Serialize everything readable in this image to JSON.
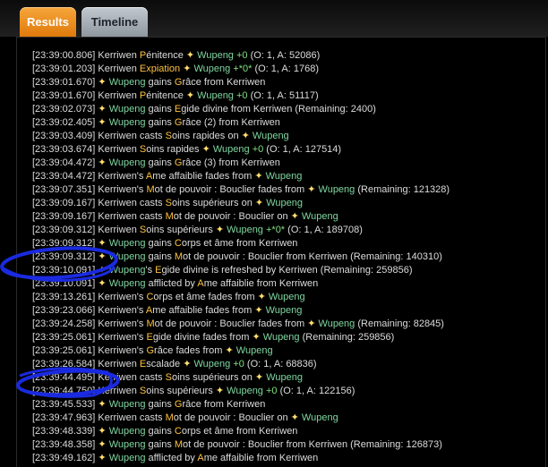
{
  "tabs": [
    {
      "label": "Results"
    },
    {
      "label": "Timeline"
    }
  ],
  "colors": {
    "accent_tab": "#f0901e",
    "player_wupeng": "#7fd6a0",
    "spell_highlight": "#ffc23d",
    "value_green": "#7fe07f",
    "annotation": "#1a2ae0"
  },
  "icons": {
    "target_marker": "star-icon"
  },
  "log": [
    [
      [
        "[23:39:00.806] ",
        "ts"
      ],
      [
        "Kerriwen ",
        "k"
      ],
      [
        "P",
        "o"
      ],
      [
        "énitence ",
        "k"
      ],
      [
        "✦ ",
        "star"
      ],
      [
        "Wupeng ",
        "w"
      ],
      [
        "+0",
        "g"
      ],
      [
        " (O: 1, A: 52086)",
        "k"
      ]
    ],
    [
      [
        "[23:39:01.203] ",
        "ts"
      ],
      [
        "Kerriwen ",
        "k"
      ],
      [
        "Expiation ",
        "o"
      ],
      [
        "✦ ",
        "star"
      ],
      [
        "Wupeng ",
        "w"
      ],
      [
        "+*0*",
        "g"
      ],
      [
        " (O: 1, A: 1768)",
        "k"
      ]
    ],
    [
      [
        "[23:39:01.670] ",
        "ts"
      ],
      [
        "✦ ",
        "star"
      ],
      [
        "Wupeng ",
        "w"
      ],
      [
        "gains ",
        "k"
      ],
      [
        "G",
        "o"
      ],
      [
        "râce from Kerriwen",
        "k"
      ]
    ],
    [
      [
        "[23:39:01.670] ",
        "ts"
      ],
      [
        "Kerriwen ",
        "k"
      ],
      [
        "P",
        "o"
      ],
      [
        "énitence ",
        "k"
      ],
      [
        "✦ ",
        "star"
      ],
      [
        "Wupeng ",
        "w"
      ],
      [
        "+0",
        "g"
      ],
      [
        " (O: 1, A: 51117)",
        "k"
      ]
    ],
    [
      [
        "[23:39:02.073] ",
        "ts"
      ],
      [
        "✦ ",
        "star"
      ],
      [
        "Wupeng ",
        "w"
      ],
      [
        "gains ",
        "k"
      ],
      [
        "E",
        "o"
      ],
      [
        "gide divine from Kerriwen (Remaining: 2400)",
        "k"
      ]
    ],
    [
      [
        "[23:39:02.405] ",
        "ts"
      ],
      [
        "✦ ",
        "star"
      ],
      [
        "Wupeng ",
        "w"
      ],
      [
        "gains ",
        "k"
      ],
      [
        "G",
        "o"
      ],
      [
        "râce (2) from Kerriwen",
        "k"
      ]
    ],
    [
      [
        "[23:39:03.409] ",
        "ts"
      ],
      [
        "Kerriwen casts ",
        "k"
      ],
      [
        "S",
        "o"
      ],
      [
        "oins rapides on ",
        "k"
      ],
      [
        "✦ ",
        "star"
      ],
      [
        "Wupeng",
        "w"
      ]
    ],
    [
      [
        "[23:39:03.674] ",
        "ts"
      ],
      [
        "Kerriwen ",
        "k"
      ],
      [
        "S",
        "o"
      ],
      [
        "oins rapides ",
        "k"
      ],
      [
        "✦ ",
        "star"
      ],
      [
        "Wupeng ",
        "w"
      ],
      [
        "+0",
        "g"
      ],
      [
        " (O: 1, A: 127514)",
        "k"
      ]
    ],
    [
      [
        "[23:39:04.472] ",
        "ts"
      ],
      [
        "✦ ",
        "star"
      ],
      [
        "Wupeng ",
        "w"
      ],
      [
        "gains ",
        "k"
      ],
      [
        "G",
        "o"
      ],
      [
        "râce (3) from Kerriwen",
        "k"
      ]
    ],
    [
      [
        "[23:39:04.472] ",
        "ts"
      ],
      [
        "Kerriwen's ",
        "k"
      ],
      [
        "A",
        "o"
      ],
      [
        "me affaiblie fades from ",
        "k"
      ],
      [
        "✦ ",
        "star"
      ],
      [
        "Wupeng",
        "w"
      ]
    ],
    [
      [
        "[23:39:07.351] ",
        "ts"
      ],
      [
        "Kerriwen's ",
        "k"
      ],
      [
        "M",
        "o"
      ],
      [
        "ot de pouvoir : Bouclier fades from ",
        "k"
      ],
      [
        "✦ ",
        "star"
      ],
      [
        "Wupeng ",
        "w"
      ],
      [
        "(Remaining: 121328)",
        "k"
      ]
    ],
    [
      [
        "[23:39:09.167] ",
        "ts"
      ],
      [
        "Kerriwen casts ",
        "k"
      ],
      [
        "S",
        "o"
      ],
      [
        "oins supérieurs on ",
        "k"
      ],
      [
        "✦ ",
        "star"
      ],
      [
        "Wupeng",
        "w"
      ]
    ],
    [
      [
        "[23:39:09.167] ",
        "ts"
      ],
      [
        "Kerriwen casts ",
        "k"
      ],
      [
        "M",
        "o"
      ],
      [
        "ot de pouvoir : Bouclier on ",
        "k"
      ],
      [
        "✦ ",
        "star"
      ],
      [
        "Wupeng",
        "w"
      ]
    ],
    [
      [
        "[23:39:09.312] ",
        "ts"
      ],
      [
        "Kerriwen ",
        "k"
      ],
      [
        "S",
        "o"
      ],
      [
        "oins supérieurs ",
        "k"
      ],
      [
        "✦ ",
        "star"
      ],
      [
        "Wupeng ",
        "w"
      ],
      [
        "+*0*",
        "g"
      ],
      [
        " (O: 1, A: 189708)",
        "k"
      ]
    ],
    [
      [
        "[23:39:09.312] ",
        "ts"
      ],
      [
        "✦ ",
        "star"
      ],
      [
        "Wupeng ",
        "w"
      ],
      [
        "gains ",
        "k"
      ],
      [
        "C",
        "o"
      ],
      [
        "orps et âme from Kerriwen",
        "k"
      ]
    ],
    [
      [
        "[23:39:09.312] ",
        "ts"
      ],
      [
        "✦ ",
        "star"
      ],
      [
        "Wupeng ",
        "w"
      ],
      [
        "gains ",
        "k"
      ],
      [
        "M",
        "o"
      ],
      [
        "ot de pouvoir : Bouclier from Kerriwen (Remaining: 140310)",
        "k"
      ]
    ],
    [
      [
        "[23:39:10.091] ",
        "ts"
      ],
      [
        "✦ ",
        "star"
      ],
      [
        "Wupeng",
        "w"
      ],
      [
        "'s ",
        "k"
      ],
      [
        "E",
        "o"
      ],
      [
        "gide divine is refreshed by Kerriwen (Remaining: 259856)",
        "k"
      ]
    ],
    [
      [
        "[23:39:10.091] ",
        "ts"
      ],
      [
        "✦ ",
        "star"
      ],
      [
        "Wupeng ",
        "w"
      ],
      [
        "afflicted by ",
        "k"
      ],
      [
        "A",
        "o"
      ],
      [
        "me affaiblie from Kerriwen",
        "k"
      ]
    ],
    [
      [
        "[23:39:13.261] ",
        "ts"
      ],
      [
        "Kerriwen's ",
        "k"
      ],
      [
        "C",
        "o"
      ],
      [
        "orps et âme fades from ",
        "k"
      ],
      [
        "✦ ",
        "star"
      ],
      [
        "Wupeng",
        "w"
      ]
    ],
    [
      [
        "[23:39:23.066] ",
        "ts"
      ],
      [
        "Kerriwen's ",
        "k"
      ],
      [
        "A",
        "o"
      ],
      [
        "me affaiblie fades from ",
        "k"
      ],
      [
        "✦ ",
        "star"
      ],
      [
        "Wupeng",
        "w"
      ]
    ],
    [
      [
        "[23:39:24.258] ",
        "ts"
      ],
      [
        "Kerriwen's ",
        "k"
      ],
      [
        "M",
        "o"
      ],
      [
        "ot de pouvoir : Bouclier fades from ",
        "k"
      ],
      [
        "✦ ",
        "star"
      ],
      [
        "Wupeng ",
        "w"
      ],
      [
        "(Remaining: 82845)",
        "k"
      ]
    ],
    [
      [
        "[23:39:25.061] ",
        "ts"
      ],
      [
        "Kerriwen's ",
        "k"
      ],
      [
        "E",
        "o"
      ],
      [
        "gide divine fades from ",
        "k"
      ],
      [
        "✦ ",
        "star"
      ],
      [
        "Wupeng ",
        "w"
      ],
      [
        "(Remaining: 259856)",
        "k"
      ]
    ],
    [
      [
        "[23:39:25.061] ",
        "ts"
      ],
      [
        "Kerriwen's ",
        "k"
      ],
      [
        "G",
        "o"
      ],
      [
        "râce fades from ",
        "k"
      ],
      [
        "✦ ",
        "star"
      ],
      [
        "Wupeng",
        "w"
      ]
    ],
    [
      [
        "[23:39:26.584] ",
        "ts"
      ],
      [
        "Kerriwen ",
        "k"
      ],
      [
        "E",
        "o"
      ],
      [
        "scalade ",
        "k"
      ],
      [
        "✦ ",
        "star"
      ],
      [
        "Wupeng ",
        "w"
      ],
      [
        "+0",
        "g"
      ],
      [
        " (O: 1, A: 68836)",
        "k"
      ]
    ],
    [
      [
        "[23:39:44.495] ",
        "ts"
      ],
      [
        "Kerriwen casts ",
        "k"
      ],
      [
        "S",
        "o"
      ],
      [
        "oins supérieurs on ",
        "k"
      ],
      [
        "✦ ",
        "star"
      ],
      [
        "Wupeng",
        "w"
      ]
    ],
    [
      [
        "[23:39:44.750] ",
        "ts"
      ],
      [
        "Kerriwen ",
        "k"
      ],
      [
        "S",
        "o"
      ],
      [
        "oins supérieurs ",
        "k"
      ],
      [
        "✦ ",
        "star"
      ],
      [
        "Wupeng ",
        "w"
      ],
      [
        "+0",
        "g"
      ],
      [
        " (O: 1, A: 122156)",
        "k"
      ]
    ],
    [
      [
        "[23:39:45.533] ",
        "ts"
      ],
      [
        "✦ ",
        "star"
      ],
      [
        "Wupeng ",
        "w"
      ],
      [
        "gains ",
        "k"
      ],
      [
        "G",
        "o"
      ],
      [
        "râce from Kerriwen",
        "k"
      ]
    ],
    [
      [
        "[23:39:47.963] ",
        "ts"
      ],
      [
        "Kerriwen casts ",
        "k"
      ],
      [
        "M",
        "o"
      ],
      [
        "ot de pouvoir : Bouclier on ",
        "k"
      ],
      [
        "✦ ",
        "star"
      ],
      [
        "Wupeng",
        "w"
      ]
    ],
    [
      [
        "[23:39:48.339] ",
        "ts"
      ],
      [
        "✦ ",
        "star"
      ],
      [
        "Wupeng ",
        "w"
      ],
      [
        "gains ",
        "k"
      ],
      [
        "C",
        "o"
      ],
      [
        "orps et âme from Kerriwen",
        "k"
      ]
    ],
    [
      [
        "[23:39:48.358] ",
        "ts"
      ],
      [
        "✦ ",
        "star"
      ],
      [
        "Wupeng ",
        "w"
      ],
      [
        "gains ",
        "k"
      ],
      [
        "M",
        "o"
      ],
      [
        "ot de pouvoir : Bouclier from Kerriwen (Remaining: 126873)",
        "k"
      ]
    ],
    [
      [
        "[23:39:49.162] ",
        "ts"
      ],
      [
        "✦ ",
        "star"
      ],
      [
        "Wupeng ",
        "w"
      ],
      [
        "afflicted by ",
        "k"
      ],
      [
        "A",
        "o"
      ],
      [
        "me affaiblie from Kerriwen",
        "k"
      ]
    ]
  ]
}
